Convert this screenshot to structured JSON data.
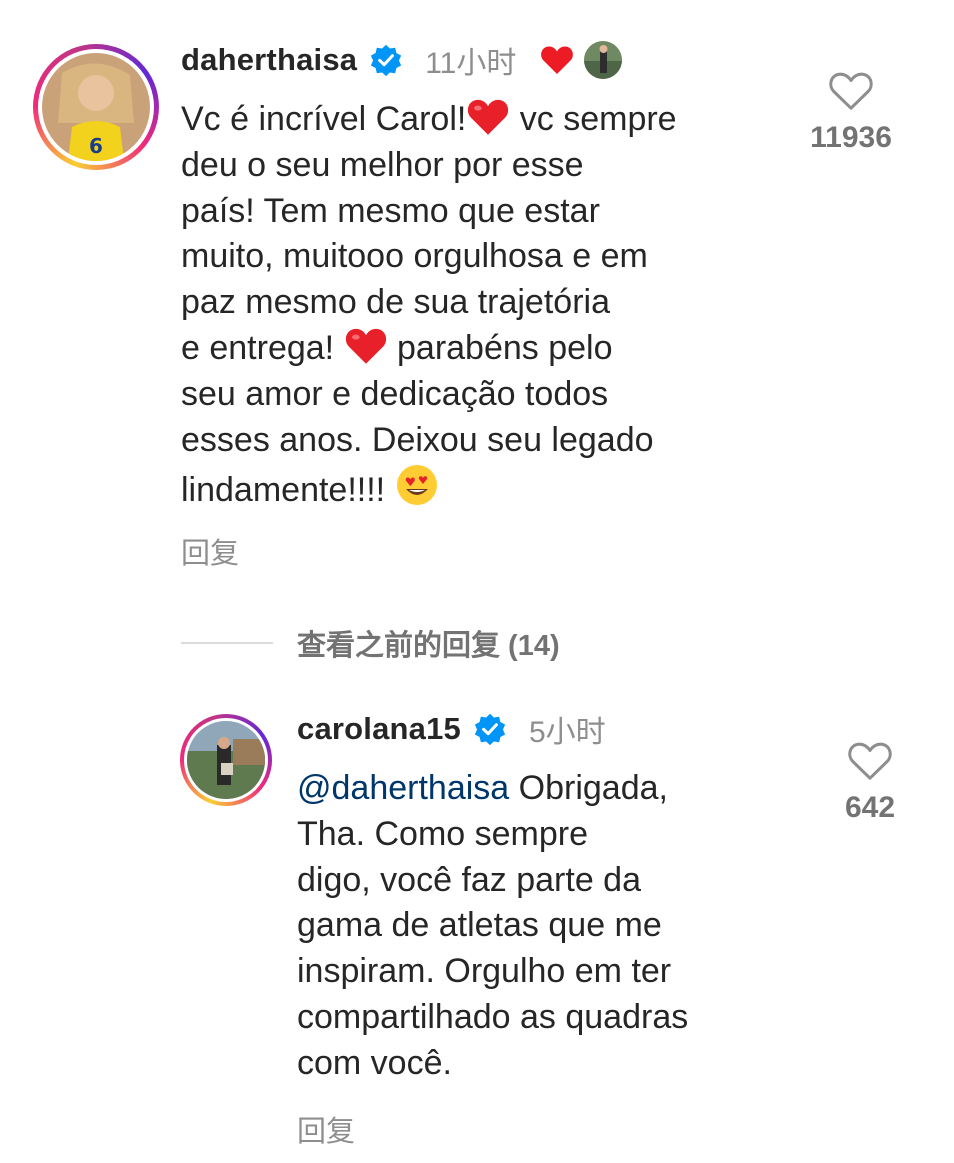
{
  "comments": [
    {
      "username": "daherthaisa",
      "time": "11小时",
      "text_lines": [
        "Vc é incrível Carol!",
        " vc sempre",
        "deu o seu melhor por esse",
        "país! Tem mesmo que estar",
        "muito, muitooo orgulhosa e em",
        "paz mesmo de sua trajetória",
        "e entrega! ",
        " parabéns pelo",
        "seu amor e dedicação todos",
        "esses anos. Deixou seu legado",
        "lindamente!!!! "
      ],
      "likes": "11936",
      "reply_label": "回复",
      "emojis": [
        "red-heart",
        "red-heart",
        "heart-eyes"
      ]
    },
    {
      "username": "carolana15",
      "time": "5小时",
      "mention": "@daherthaisa",
      "text_lines": [
        " Obrigada,",
        "Tha. Como sempre",
        "digo, você faz parte da",
        "gama de atletas que me",
        "inspiram. Orgulho em ter",
        "compartilhado as quadras",
        "com você."
      ],
      "likes": "642",
      "reply_label": "回复"
    }
  ],
  "view_previous_replies": "查看之前的回复 (14)",
  "colors": {
    "username": "#262626",
    "meta": "#8e8e8e",
    "mention": "#00376b",
    "verified": "#0095f6",
    "heart": "#ed1c24"
  }
}
